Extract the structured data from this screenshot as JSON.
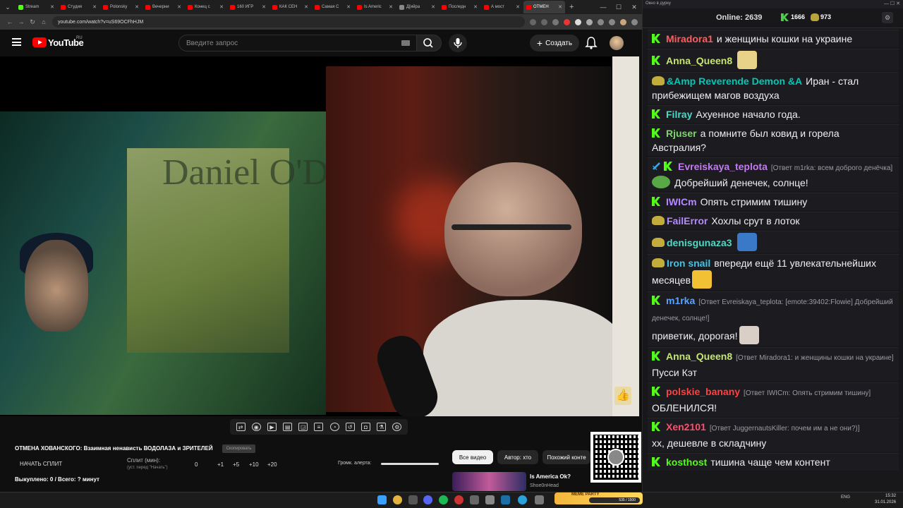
{
  "browser": {
    "tabs": [
      {
        "label": "Stream",
        "color": "#53fc18"
      },
      {
        "label": "Студия",
        "color": "#ff0000"
      },
      {
        "label": "Polonsky",
        "color": "#ff0000"
      },
      {
        "label": "Вечерни",
        "color": "#ff0000"
      },
      {
        "label": "Конец с",
        "color": "#ff0000"
      },
      {
        "label": "160 ИГР",
        "color": "#ff0000"
      },
      {
        "label": "КАК СЕН",
        "color": "#ff0000"
      },
      {
        "label": "Самая С",
        "color": "#ff0000"
      },
      {
        "label": "Is Americ",
        "color": "#ff0000"
      },
      {
        "label": "Д[ийра",
        "color": "#888888"
      },
      {
        "label": "Последн",
        "color": "#ff0000"
      },
      {
        "label": "А мост",
        "color": "#ff0000"
      },
      {
        "label": "ОТМЕН",
        "color": "#ff0000",
        "active": true
      }
    ],
    "url": "youtube.com/watch?v=uS69OCFhHJM"
  },
  "youtube": {
    "logo_text": "YouTube",
    "country": "RU",
    "search_placeholder": "Введите запрос",
    "create_label": "Создать"
  },
  "video": {
    "poster_text": "Daniel O'D"
  },
  "overlay": {
    "title": "ОТМЕНА ХОВАНСКОГО: Взаимная ненависть ВОДОЛАЗА и ЗРИТЕЛЕЙ",
    "badge": "Скопировать",
    "split_button": "НАЧАТЬ СПЛИТ",
    "split_label": "Сплит (мин):",
    "split_hint": "(уст. перед \"Начать\")",
    "split_values": [
      "0",
      "+1",
      "+5",
      "+10",
      "+20"
    ],
    "alert_label": "Громк. алерта:",
    "bought": "Выкуплено: 0 / Всего: ? минут"
  },
  "chips": [
    "Все видео",
    "Автор: хто",
    "Похожий конте"
  ],
  "recommendation": {
    "title": "Is America Ok?",
    "channel": "Shoe0nHead"
  },
  "chat": {
    "window_title": "Окно в дурку",
    "online_label": "Online:",
    "online_count": "2639",
    "k_count": "1666",
    "pepe_count": "973",
    "messages": [
      {
        "badge": "k",
        "user": "Miradora1",
        "color": "#ff5d5d",
        "text": "и женщины кошки на украине"
      },
      {
        "badge": "k",
        "user": "Anna_Queen8",
        "color": "#c6e573",
        "text": "",
        "emote": "#e8d28a"
      },
      {
        "badge": "pepe",
        "user": "&Amp Reverende Demon &A",
        "color": "#00c8b4",
        "text": "Иран - стал прибежищем магов воздуха"
      },
      {
        "badge": "k",
        "user": "Filray",
        "color": "#4fd8c5",
        "text": "Ахуенное начало года."
      },
      {
        "badge": "k",
        "user": "Rjuser",
        "color": "#7dd66a",
        "text": "а помните был ковид и горела Австралия?"
      },
      {
        "badge": "sword-k",
        "user": "Evreiskaya_teplota",
        "color": "#c27bf0",
        "reply": "[Ответ m1rka: всем доброго денёчка]",
        "frog": true,
        "text": "Добрейший денечек, солнце!"
      },
      {
        "badge": "k",
        "user": "IWICm",
        "color": "#b488ff",
        "text": "Опять стримим тишину"
      },
      {
        "badge": "pepe",
        "user": "FailError",
        "color": "#b488ff",
        "text": "Хохлы срут в лоток"
      },
      {
        "badge": "pepe",
        "user": "denisgunaza3",
        "color": "#4fd8c5",
        "text": "",
        "emote": "#3a78c8"
      },
      {
        "badge": "pepe",
        "user": "Iron snail",
        "color": "#3fc3e6",
        "text": "впереди ещё 11 увлекательнейших месяцев",
        "emote": "#f2c234"
      },
      {
        "badge": "k",
        "user": "m1rka",
        "color": "#5aa2ff",
        "reply": "[Ответ Evreiskaya_teplota: [emote:39402:Flowie] Добрейший денечек, солнце!]",
        "text": "приветик, дорогая!",
        "emote": "#d9cfc6"
      },
      {
        "badge": "k",
        "user": "Anna_Queen8",
        "color": "#c6e573",
        "reply": "[Ответ Miradora1: и женщины кошки на украине]",
        "text": "Пусси Кэт"
      },
      {
        "badge": "k",
        "user": "polskie_banany",
        "color": "#ff4040",
        "reply": "[Ответ IWICm: Опять стримим тишину]",
        "text": "ОБЛЕНИЛСЯ!"
      },
      {
        "badge": "k",
        "user": "Xen2101",
        "color": "#ff4f6b",
        "reply": "[Ответ JuggernautsKiller: почем им а не они?)]",
        "text": "хх, дешевле в складчину"
      },
      {
        "badge": "k",
        "user": "kosthost",
        "color": "#53fc18",
        "text": "тишина чаще чем контент"
      }
    ]
  },
  "taskbar": {
    "meme_label": "MEME PARTY",
    "meme_counter": "535 / 1500",
    "lang": "ENG",
    "time": "15:32",
    "date": "31.01.2026"
  }
}
